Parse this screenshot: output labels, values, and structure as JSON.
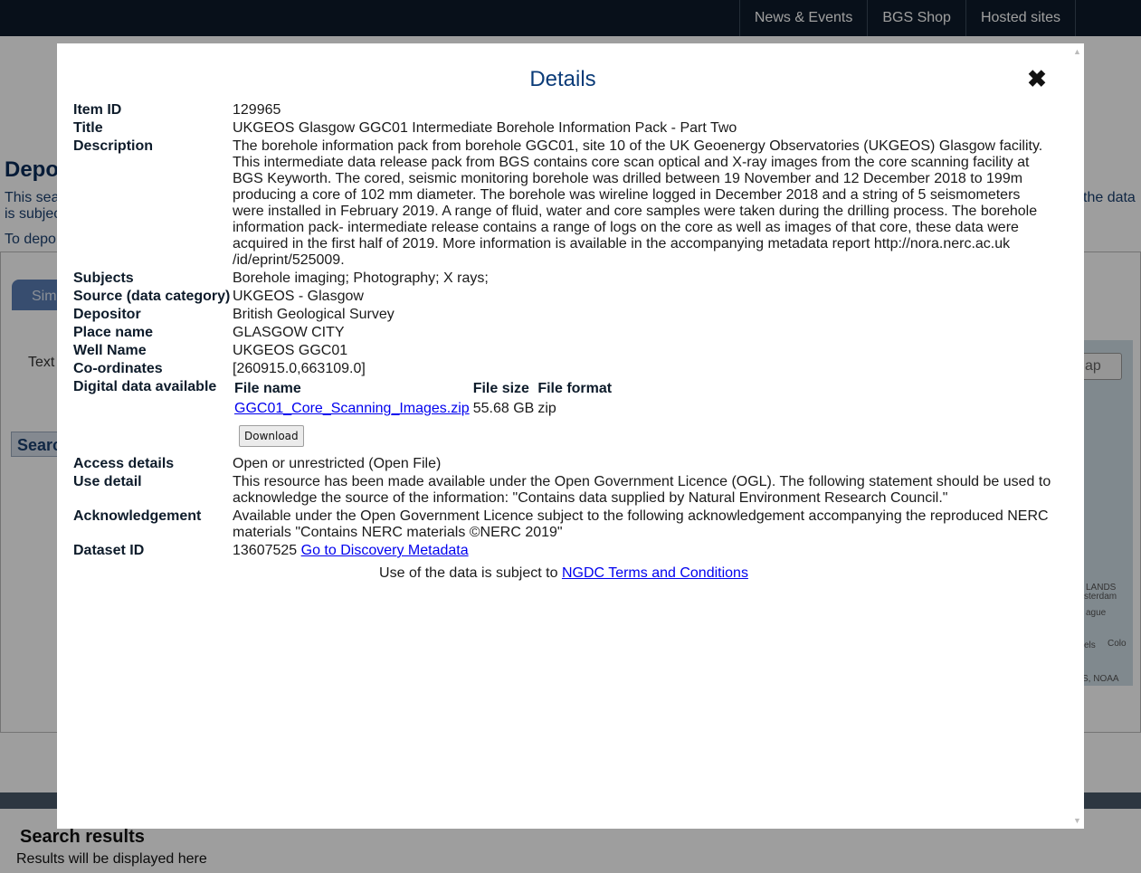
{
  "topnav": {
    "items": [
      "News & Events",
      "BGS Shop",
      "Hosted sites"
    ]
  },
  "background": {
    "heading": "Depo",
    "line1": "This sea",
    "line2": "is subjec",
    "line3": "To depo",
    "line_right": "the data",
    "tab_label": "Sim",
    "text_label": "Text",
    "search_button": "Searc",
    "map_button": "ap",
    "map_labels": [
      "LANDS",
      "sterdam",
      "ague",
      "els",
      "Colo",
      "S, NOAA"
    ],
    "results_heading": "Search results",
    "results_text": "Results will be displayed here"
  },
  "modal": {
    "title": "Details",
    "close_icon": "close-icon",
    "fields": {
      "item_id": {
        "label": "Item ID",
        "value": "129965"
      },
      "title": {
        "label": "Title",
        "value": "UKGEOS Glasgow GGC01 Intermediate Borehole Information Pack - Part Two"
      },
      "description": {
        "label": "Description",
        "lines": [
          "The borehole information pack from borehole GGC01, site 10 of the UK Geoenergy Observatories (UKGEOS) Glasgow facility.",
          "This intermediate data release pack from BGS contains core scan optical and X-ray images from the core scanning facility at",
          "BGS Keyworth. The cored, seismic monitoring borehole was drilled between 19 November and 12 December 2018 to 199m",
          "producing a core of 102 mm diameter. The borehole was wireline logged in December 2018 and a string of 5 seismometers",
          "were installed in February 2019. A range of fluid, water and core samples were taken during the drilling process. The borehole",
          "information pack- intermediate release contains a range of logs on the core as well as images of that core, these data were",
          "acquired in the first half of 2019. More information is available in the accompanying metadata report http://nora.nerc.ac.uk",
          "/id/eprint/525009."
        ]
      },
      "subjects": {
        "label": "Subjects",
        "value": "Borehole imaging; Photography; X rays;"
      },
      "source": {
        "label": "Source (data category)",
        "value": "UKGEOS - Glasgow"
      },
      "depositor": {
        "label": "Depositor",
        "value": "British Geological Survey"
      },
      "place_name": {
        "label": "Place name",
        "value": "GLASGOW CITY"
      },
      "well_name": {
        "label": "Well Name",
        "value": "UKGEOS GGC01"
      },
      "coordinates": {
        "label": "Co-ordinates",
        "value": "[260915.0,663109.0]"
      },
      "digital_data": {
        "label": "Digital data available"
      },
      "access_details": {
        "label": "Access details",
        "value": "Open or unrestricted (Open File)"
      },
      "use_detail": {
        "label": "Use detail",
        "lines": [
          "This resource has been made available under the Open Government Licence (OGL). The following statement should be used to",
          "acknowledge the source of the information: \"Contains data supplied by Natural Environment Research Council.\""
        ]
      },
      "acknowledgement": {
        "label": "Acknowledgement",
        "lines": [
          "Available under the Open Government Licence subject to the following acknowledgement accompanying the reproduced NERC",
          "materials \"Contains NERC materials ©NERC 2019\""
        ]
      },
      "dataset_id": {
        "label": "Dataset ID",
        "value": "13607525",
        "link": "Go to Discovery Metadata"
      }
    },
    "files": {
      "columns": [
        "File name",
        "File size",
        "File format"
      ],
      "rows": [
        {
          "name": "GGC01_Core_Scanning_Images.zip",
          "size": "55.68 GB",
          "format": "zip"
        }
      ],
      "download_label": "Download"
    },
    "terms": {
      "prefix": "Use of the data is subject to ",
      "link": "NGDC Terms and Conditions"
    }
  }
}
